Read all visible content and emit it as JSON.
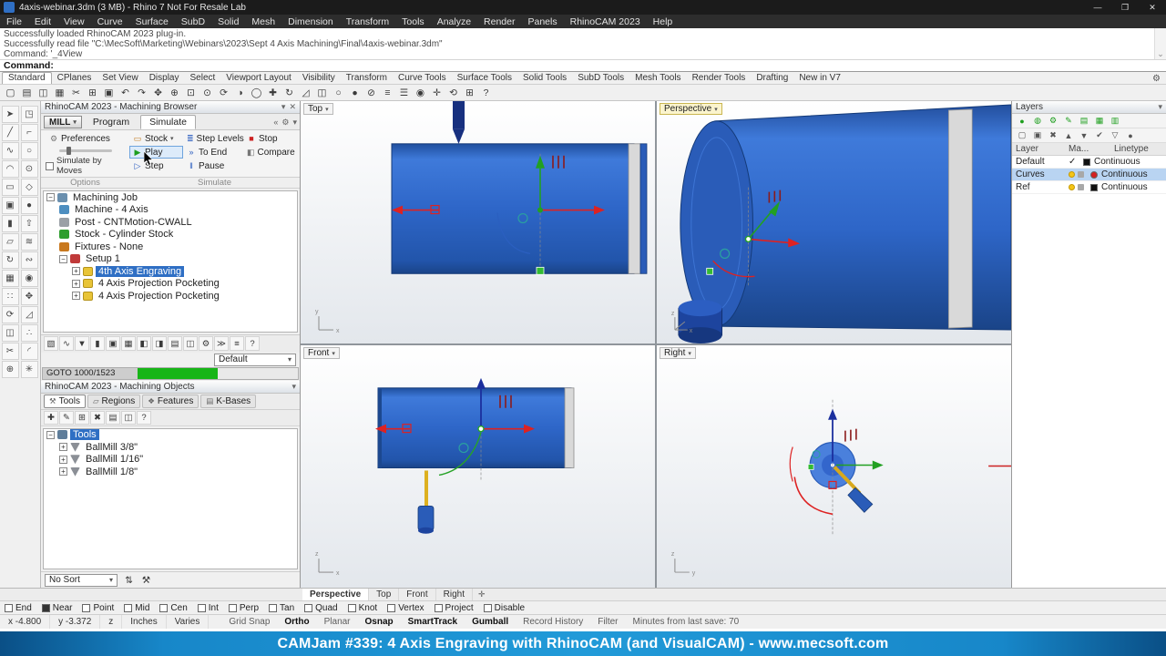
{
  "titlebar": {
    "title": "4axis-webinar.3dm (3 MB) - Rhino 7 Not For Resale Lab",
    "minimize": "—",
    "maximize": "❐",
    "close": "✕"
  },
  "menubar": {
    "items": [
      "File",
      "Edit",
      "View",
      "Curve",
      "Surface",
      "SubD",
      "Solid",
      "Mesh",
      "Dimension",
      "Transform",
      "Tools",
      "Analyze",
      "Render",
      "Panels",
      "RhinoCAM 2023",
      "Help"
    ]
  },
  "command": {
    "history": [
      "Successfully loaded RhinoCAM 2023 plug-in.",
      "Successfully read file \"C:\\MecSoft\\Marketing\\Webinars\\2023\\Sept 4 Axis Machining\\Final\\4axis-webinar.3dm\"",
      "Command: '_4View"
    ],
    "prompt": "Command:"
  },
  "tabbar": {
    "tabs": [
      {
        "label": "Standard",
        "active": true
      },
      {
        "label": "CPlanes"
      },
      {
        "label": "Set View"
      },
      {
        "label": "Display"
      },
      {
        "label": "Select"
      },
      {
        "label": "Viewport Layout"
      },
      {
        "label": "Visibility"
      },
      {
        "label": "Transform"
      },
      {
        "label": "Curve Tools"
      },
      {
        "label": "Surface Tools"
      },
      {
        "label": "Solid Tools"
      },
      {
        "label": "SubD Tools"
      },
      {
        "label": "Mesh Tools"
      },
      {
        "label": "Render Tools"
      },
      {
        "label": "Drafting"
      },
      {
        "label": "New in V7"
      }
    ]
  },
  "toolbar": {
    "icons": [
      {
        "name": "new-file",
        "glyph": "▢"
      },
      {
        "name": "open-file",
        "glyph": "▤"
      },
      {
        "name": "save-file",
        "glyph": "◫"
      },
      {
        "name": "print",
        "glyph": "▦"
      },
      {
        "name": "cut",
        "glyph": "✂"
      },
      {
        "name": "copy-clipboard",
        "glyph": "⊞"
      },
      {
        "name": "paste",
        "glyph": "▣"
      },
      {
        "name": "undo",
        "glyph": "↶"
      },
      {
        "name": "redo",
        "glyph": "↷"
      },
      {
        "name": "pan-view",
        "glyph": "✥"
      },
      {
        "name": "zoom-dynamic",
        "glyph": "⊕"
      },
      {
        "name": "zoom-window",
        "glyph": "⊡"
      },
      {
        "name": "zoom-extents",
        "glyph": "⊙"
      },
      {
        "name": "rotate-view",
        "glyph": "⟳"
      },
      {
        "name": "shaded-view",
        "glyph": "◑"
      },
      {
        "name": "wireframe-view",
        "glyph": "◯"
      },
      {
        "name": "move",
        "glyph": "✚"
      },
      {
        "name": "rotate",
        "glyph": "↻"
      },
      {
        "name": "scale",
        "glyph": "◿"
      },
      {
        "name": "mirror",
        "glyph": "◫"
      },
      {
        "name": "hide-objects",
        "glyph": "○"
      },
      {
        "name": "show-objects",
        "glyph": "●"
      },
      {
        "name": "lock-objects",
        "glyph": "⊘"
      },
      {
        "name": "layers-toggle",
        "glyph": "≡"
      },
      {
        "name": "properties-panel",
        "glyph": "☰"
      },
      {
        "name": "render",
        "glyph": "◉"
      },
      {
        "name": "gumball-toggle",
        "glyph": "✛"
      },
      {
        "name": "record-history-toggle",
        "glyph": "⟲"
      },
      {
        "name": "object-snap",
        "glyph": "⊞"
      },
      {
        "name": "help",
        "glyph": "?"
      }
    ]
  },
  "side_toolbar": {
    "icons": [
      {
        "name": "select-pointer",
        "glyph": "➤"
      },
      {
        "name": "selection-filter",
        "glyph": "◳"
      },
      {
        "name": "line",
        "glyph": "╱"
      },
      {
        "name": "polyline",
        "glyph": "⌐"
      },
      {
        "name": "curve",
        "glyph": "∿"
      },
      {
        "name": "circle",
        "glyph": "○"
      },
      {
        "name": "arc",
        "glyph": "◠"
      },
      {
        "name": "ellipse",
        "glyph": "⊙"
      },
      {
        "name": "rectangle",
        "glyph": "▭"
      },
      {
        "name": "polygon",
        "glyph": "◇"
      },
      {
        "name": "box",
        "glyph": "▣"
      },
      {
        "name": "sphere",
        "glyph": "●"
      },
      {
        "name": "cylinder",
        "glyph": "▮"
      },
      {
        "name": "extrude",
        "glyph": "⇧"
      },
      {
        "name": "surface",
        "glyph": "▱"
      },
      {
        "name": "loft",
        "glyph": "≋"
      },
      {
        "name": "revolve",
        "glyph": "↻"
      },
      {
        "name": "sweep",
        "glyph": "∾"
      },
      {
        "name": "mesh",
        "glyph": "▦"
      },
      {
        "name": "subd",
        "glyph": "◉"
      },
      {
        "name": "points",
        "glyph": "∷"
      },
      {
        "name": "move-tool",
        "glyph": "✥"
      },
      {
        "name": "rotate-tool",
        "glyph": "⟳"
      },
      {
        "name": "scale-tool",
        "glyph": "◿"
      },
      {
        "name": "mirror-tool",
        "glyph": "◫"
      },
      {
        "name": "array-tool",
        "glyph": "∴"
      },
      {
        "name": "trim",
        "glyph": "✂"
      },
      {
        "name": "fillet",
        "glyph": "◜"
      },
      {
        "name": "join",
        "glyph": "⊕"
      },
      {
        "name": "explode",
        "glyph": "✳"
      }
    ]
  },
  "browser": {
    "header": "RhinoCAM 2023 - Machining Browser",
    "mill_label": "MILL",
    "tabs": {
      "program": "Program",
      "simulate": "Simulate"
    },
    "ribbon": {
      "preferences": {
        "label": "Preferences",
        "glyph": "⚙"
      },
      "stock": {
        "label": "Stock",
        "glyph": "▭"
      },
      "play": {
        "label": "Play",
        "glyph": "▶"
      },
      "step": {
        "label": "Step",
        "glyph": "▷"
      },
      "step_levels": {
        "label": "Step Levels",
        "glyph": "≣"
      },
      "to_end": {
        "label": "To End",
        "glyph": "»"
      },
      "pause": {
        "label": "Pause",
        "glyph": "‖"
      },
      "stop": {
        "label": "Stop",
        "glyph": "■"
      },
      "compare": {
        "label": "Compare",
        "glyph": "◧"
      },
      "simulate_by_moves": "Simulate by Moves",
      "options_label": "Options",
      "group_label": "Simulate"
    },
    "tree": {
      "job": "Machining Job",
      "machine": "Machine - 4 Axis",
      "post": "Post - CNTMotion-CWALL",
      "stock": "Stock - Cylinder Stock",
      "fixtures": "Fixtures - None",
      "setup": "Setup 1",
      "op1": "4th Axis Engraving",
      "op2": "4 Axis Projection Pocketing",
      "op3": "4 Axis Projection Pocketing"
    },
    "sim_icons": [
      {
        "name": "sim-stock-visibility",
        "glyph": "▧"
      },
      {
        "name": "sim-toolpath-visibility",
        "glyph": "∿"
      },
      {
        "name": "sim-tool-visibility",
        "glyph": "▼"
      },
      {
        "name": "sim-holder-visibility",
        "glyph": "▮"
      },
      {
        "name": "sim-fixture-visibility",
        "glyph": "▣"
      },
      {
        "name": "sim-machine-visibility",
        "glyph": "▦"
      },
      {
        "name": "sim-stock-section",
        "glyph": "◧"
      },
      {
        "name": "sim-compare-view",
        "glyph": "◨"
      },
      {
        "name": "sim-report",
        "glyph": "▤"
      },
      {
        "name": "sim-save-stock",
        "glyph": "◫"
      },
      {
        "name": "sim-settings",
        "glyph": "⚙"
      },
      {
        "name": "sim-speed",
        "glyph": "≫"
      },
      {
        "name": "sim-legend",
        "glyph": "≡"
      },
      {
        "name": "sim-help",
        "glyph": "?"
      }
    ],
    "default_label": "Default",
    "goto_label": "GOTO 1000/1523",
    "progress_percent": 50
  },
  "objects": {
    "header": "RhinoCAM 2023 - Machining Objects",
    "tabs": [
      {
        "label": "Tools",
        "glyph": "⚒",
        "active": true
      },
      {
        "label": "Regions",
        "glyph": "▱"
      },
      {
        "label": "Features",
        "glyph": "❖"
      },
      {
        "label": "K-Bases",
        "glyph": "▤"
      }
    ],
    "obj_icons": [
      {
        "name": "create-tool",
        "glyph": "✚"
      },
      {
        "name": "edit-tool",
        "glyph": "✎"
      },
      {
        "name": "duplicate-tool",
        "glyph": "⊞"
      },
      {
        "name": "delete-tool",
        "glyph": "✖"
      },
      {
        "name": "load-tool-library",
        "glyph": "▤"
      },
      {
        "name": "save-tool-library",
        "glyph": "◫"
      },
      {
        "name": "tool-help",
        "glyph": "?"
      }
    ],
    "tree_root": "Tools",
    "tools": [
      {
        "label": "BallMill 3/8\""
      },
      {
        "label": "BallMill 1/16\""
      },
      {
        "label": "BallMill 1/8\""
      }
    ],
    "sort_label": "No Sort"
  },
  "layers": {
    "title": "Layers",
    "toolbar_row1": [
      {
        "name": "layer-state-on",
        "glyph": "●"
      },
      {
        "name": "layer-state-mixed",
        "glyph": "◍"
      },
      {
        "name": "layer-settings-gear",
        "glyph": "⚙"
      },
      {
        "name": "layer-edit",
        "glyph": "✎"
      },
      {
        "name": "layer-folder",
        "glyph": "▤"
      },
      {
        "name": "layer-grid-view",
        "glyph": "▦"
      },
      {
        "name": "layer-detail-view",
        "glyph": "▥"
      }
    ],
    "toolbar_row2": [
      {
        "name": "new-layer",
        "glyph": "▢"
      },
      {
        "name": "new-sublayer",
        "glyph": "▣"
      },
      {
        "name": "delete-layer",
        "glyph": "✖"
      },
      {
        "name": "move-layer-up",
        "glyph": "▲"
      },
      {
        "name": "move-layer-down",
        "glyph": "▼"
      },
      {
        "name": "match-layer",
        "glyph": "✔"
      },
      {
        "name": "filter-layers",
        "glyph": "▽"
      },
      {
        "name": "layer-help",
        "glyph": "●"
      }
    ],
    "columns": [
      "Layer",
      "Ma...",
      "Linetype"
    ],
    "rows": [
      {
        "name": "Default",
        "linetype": "Continuous"
      },
      {
        "name": "Curves",
        "linetype": "Continuous"
      },
      {
        "name": "Ref",
        "linetype": "Continuous"
      }
    ]
  },
  "viewports": {
    "top_label": "Top",
    "perspective_label": "Perspective",
    "front_label": "Front",
    "right_label": "Right"
  },
  "viewport_tabs": {
    "tabs": [
      {
        "label": "Perspective",
        "active": true
      },
      {
        "label": "Top"
      },
      {
        "label": "Front"
      },
      {
        "label": "Right"
      }
    ]
  },
  "osnap": {
    "toggles": [
      {
        "label": "End"
      },
      {
        "label": "Near",
        "checked": true
      },
      {
        "label": "Point"
      },
      {
        "label": "Mid"
      },
      {
        "label": "Cen"
      },
      {
        "label": "Int"
      },
      {
        "label": "Perp"
      },
      {
        "label": "Tan"
      },
      {
        "label": "Quad"
      },
      {
        "label": "Knot"
      },
      {
        "label": "Vertex"
      },
      {
        "label": "Project"
      },
      {
        "label": "Disable"
      }
    ]
  },
  "statusbar": {
    "cells": [
      "x -4.800",
      "y -3.372",
      "z",
      "Inches",
      "Varies"
    ],
    "toggles": [
      {
        "label": "Grid Snap"
      },
      {
        "label": "Ortho",
        "active": true
      },
      {
        "label": "Planar"
      },
      {
        "label": "Osnap",
        "active": true
      },
      {
        "label": "SmartTrack",
        "active": true
      },
      {
        "label": "Gumball",
        "active": true
      },
      {
        "label": "Record History"
      },
      {
        "label": "Filter"
      },
      {
        "label": "Minutes from last save: 70"
      }
    ]
  },
  "banner": {
    "text": "CAMJam #339: 4 Axis Engraving with RhinoCAM (and VisualCAM) - www.mecsoft.com"
  },
  "ui": {
    "collapse": "−",
    "expand": "+",
    "arrow": "▾",
    "check": "✓",
    "scroll_arrow": "⌄",
    "plus": "✛"
  },
  "colors": {
    "cylinder_blue": "#2e63c6",
    "progress_green": "#17b517",
    "banner_blue": "#1787c9",
    "selection_blue": "#2f6fc4"
  }
}
